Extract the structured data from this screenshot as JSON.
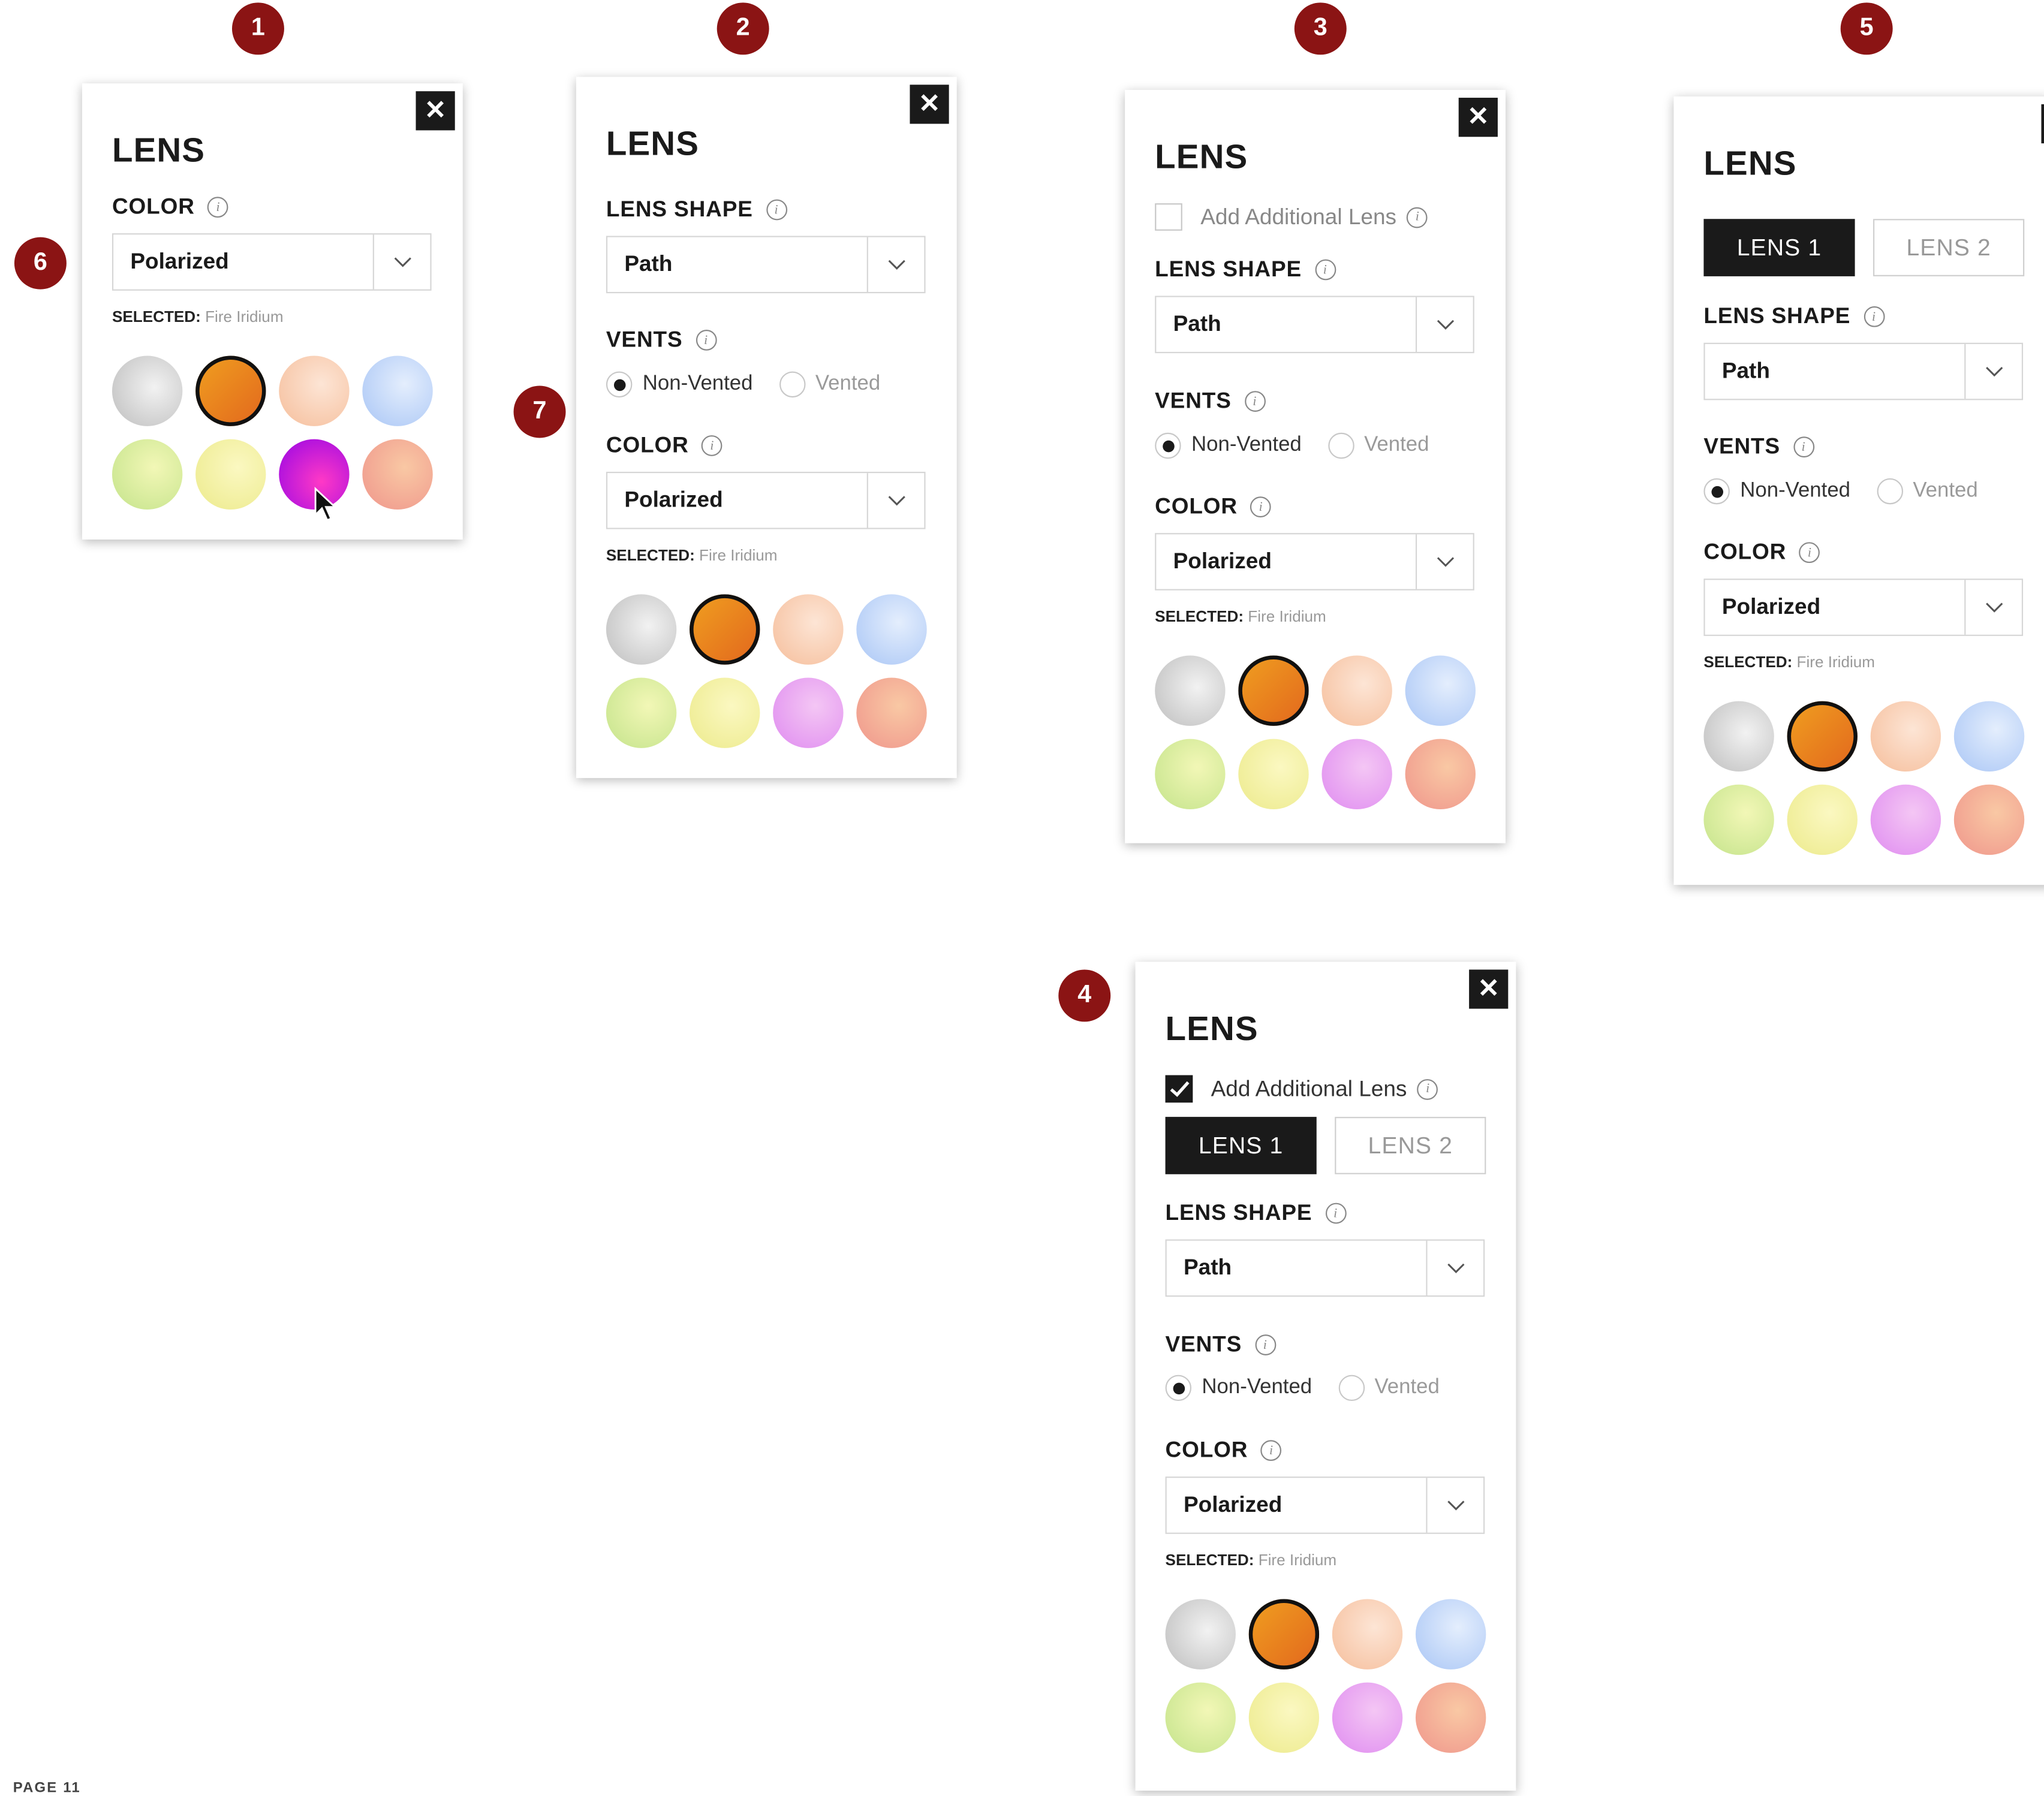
{
  "badges": [
    "1",
    "2",
    "3",
    "4",
    "5",
    "6",
    "7"
  ],
  "colors": {
    "badge": "#8b1414",
    "accent_dark": "#1a1a1a",
    "swatches": [
      "gray",
      "orange",
      "peach",
      "light-blue",
      "lime",
      "yellow",
      "magenta",
      "salmon"
    ]
  },
  "common": {
    "close_label": "✕",
    "title": "LENS",
    "lens_shape_label": "LENS SHAPE",
    "lens_shape_value": "Path",
    "vents_label": "VENTS",
    "non_vented": "Non-Vented",
    "vented": "Vented",
    "color_label": "COLOR",
    "color_value": "Polarized",
    "selected_key": "SELECTED:",
    "selected_value": "Fire Iridium",
    "add_lens_label": "Add Additional Lens",
    "lens1_tab": "LENS 1",
    "lens2_tab": "LENS 2",
    "info_icon": "i"
  },
  "footer": "PAGE 11"
}
